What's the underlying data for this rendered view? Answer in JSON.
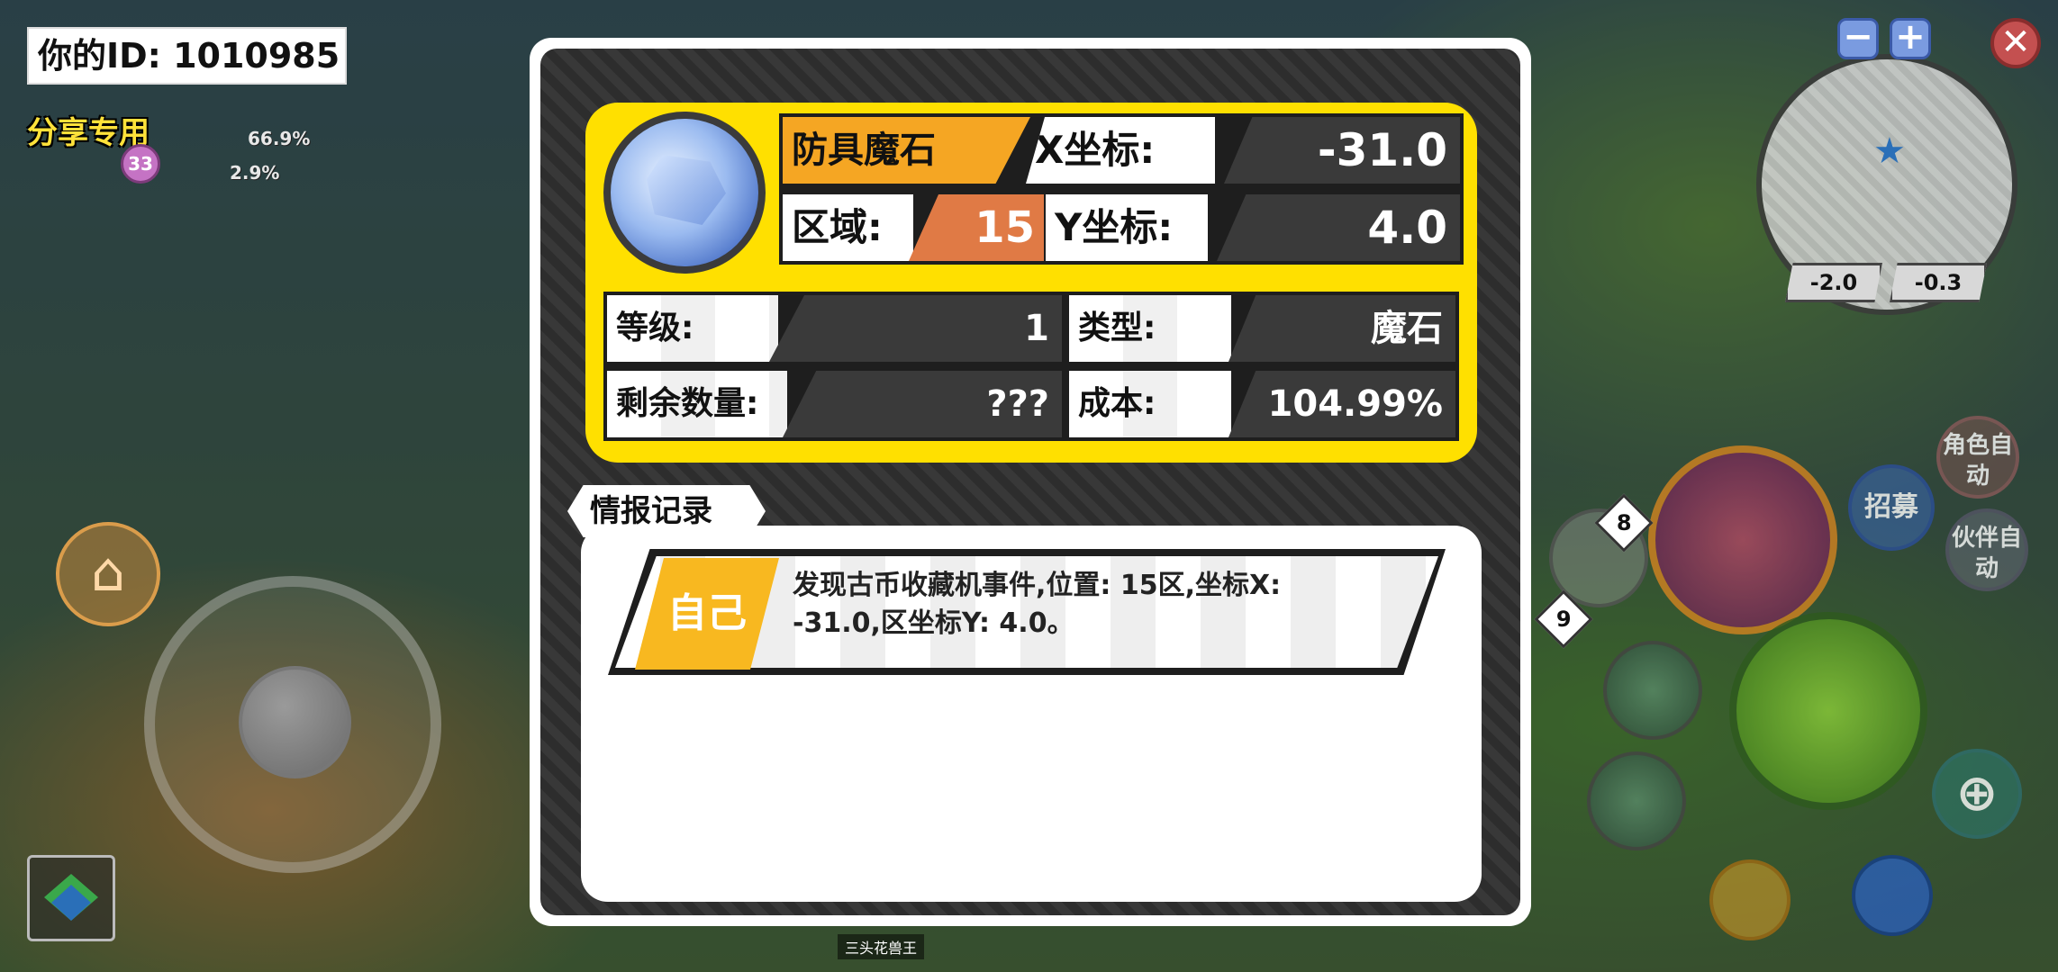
{
  "hud": {
    "player_id": "你的ID: 1010985",
    "share_label": "分享专用",
    "stat1_pct": "66.9%",
    "stat2_pct": "2.9%",
    "level_badge": "33"
  },
  "minimap": {
    "zoom_out": "−",
    "zoom_in": "+",
    "close": "✕",
    "coord_x": "-2.0",
    "coord_y": "-0.3"
  },
  "buttons": {
    "role_auto": "角色自动",
    "partner_auto": "伙伴自动",
    "recruit": "招募",
    "potion_count": "8",
    "item_count": "9"
  },
  "boss_label": "三头花兽王",
  "item": {
    "name": "防具魔石",
    "region_label": "区域:",
    "region_value": "15",
    "x_label": "X坐标:",
    "x_value": "-31.0",
    "y_label": "Y坐标:",
    "y_value": "4.0",
    "level_label": "等级:",
    "level_value": "1",
    "type_label": "类型:",
    "type_value": "魔石",
    "remain_label": "剩余数量:",
    "remain_value": "???",
    "cost_label": "成本:",
    "cost_value": "104.99%"
  },
  "intel": {
    "title": "情报记录",
    "entries": [
      {
        "who": "自己",
        "text": "发现古币收藏机事件,位置: 15区,坐标X: -31.0,区坐标Y: 4.0。"
      }
    ]
  },
  "colors": {
    "card_yellow": "#ffe000",
    "name_orange": "#f5a623",
    "region_orange": "#e07a45"
  }
}
